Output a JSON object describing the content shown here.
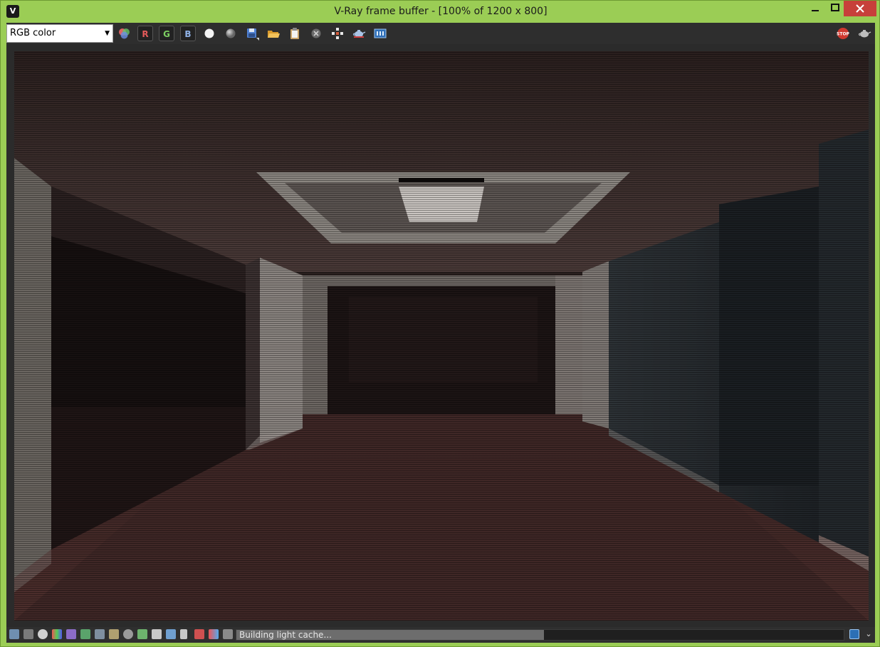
{
  "window": {
    "title": "V-Ray frame buffer - [100% of 1200 x 800]",
    "minimize_label": "_",
    "maximize_label": "□",
    "close_label": "✕",
    "app_icon_glyph": "V"
  },
  "toolbar": {
    "channel_select_value": "RGB color",
    "channel_r_label": "R",
    "channel_g_label": "G",
    "channel_b_label": "B",
    "icons": [
      "color-channels-icon",
      "channel-r-icon",
      "channel-g-icon",
      "channel-b-icon",
      "white-sphere-icon",
      "gray-sphere-icon",
      "save-icon",
      "open-icon",
      "clipboard-icon",
      "clear-icon",
      "track-mouse-icon",
      "teapot-icon",
      "vfb-history-icon",
      "stop-icon",
      "render-teapot-icon"
    ],
    "stop_label": "STOP"
  },
  "status": {
    "progress_text": "Building light cache...",
    "progress_fraction": 0.507
  },
  "colors": {
    "window_frame": "#9bcd55",
    "toolbar_bg": "#2e2e2e",
    "close_red": "#c7403a",
    "channel_r": "#e35a5a",
    "channel_g": "#7ccf62",
    "channel_b": "#8fb2e6"
  }
}
